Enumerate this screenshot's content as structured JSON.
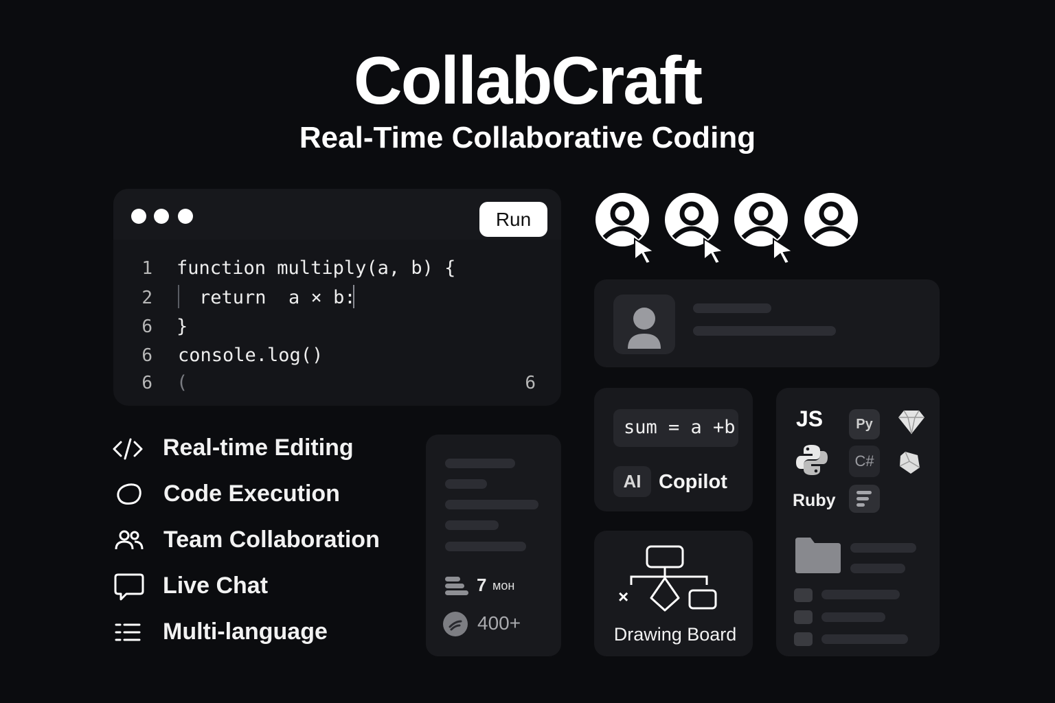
{
  "header": {
    "title": "CollabCraft",
    "subtitle": "Real-Time Collaborative Coding"
  },
  "editor": {
    "run_label": "Run",
    "lines": [
      {
        "num": "1",
        "code": "function multiply(a, b) {"
      },
      {
        "num": "2",
        "code": "return  a × b:"
      },
      {
        "num": "6",
        "code": "}"
      },
      {
        "num": "6",
        "code": "console.log()"
      },
      {
        "num": "6",
        "code": "("
      }
    ],
    "right_marker": "6"
  },
  "features": [
    {
      "icon": "code-icon",
      "label": "Real-time Editing"
    },
    {
      "icon": "execution-circle-icon",
      "label": "Code Execution"
    },
    {
      "icon": "team-icon",
      "label": "Team Collaboration"
    },
    {
      "icon": "chat-bubble-icon",
      "label": "Live Chat"
    },
    {
      "icon": "list-icon",
      "label": "Multi-language"
    }
  ],
  "stats": {
    "count_value": "7",
    "count_unit": "мон",
    "users_value": "400+"
  },
  "copilot": {
    "code_snippet": "sum = a +b",
    "ai_badge": "AI",
    "label": "Copilot"
  },
  "drawing_board": {
    "label": "Drawing Board",
    "x_mark": "×"
  },
  "languages": {
    "js": "JS",
    "py": "Py",
    "csharp": "C#",
    "ruby": "Ruby"
  },
  "colors": {
    "background": "#0b0c0f",
    "panel": "#18191d",
    "accent": "#ffffff"
  }
}
